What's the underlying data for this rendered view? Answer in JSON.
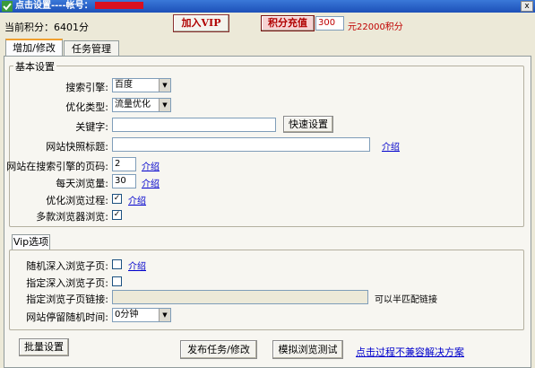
{
  "window": {
    "title": "点击设置----帐号：",
    "close": "x"
  },
  "topbar": {
    "points_label": "当前积分：6401分",
    "vip_button": "加入VIP",
    "recharge_button": "积分充值",
    "recharge_amount": "300",
    "recharge_rate": "元22000积分"
  },
  "tabs": [
    "增加/修改",
    "任务管理"
  ],
  "basic": {
    "legend": "基本设置",
    "search_engine_label": "搜索引擎:",
    "search_engine_value": "百度",
    "optimize_type_label": "优化类型:",
    "optimize_type_value": "流量优化",
    "keyword_label": "关键字:",
    "keyword_value": "",
    "quick_setup_button": "快速设置",
    "snapshot_title_label": "网站快照标题:",
    "snapshot_title_value": "",
    "snapshot_intro": "介绍",
    "page_number_label": "网站在搜索引擎的页码:",
    "page_number_value": "2",
    "page_number_intro": "介绍",
    "daily_views_label": "每天浏览量:",
    "daily_views_value": "30",
    "daily_views_intro": "介绍",
    "optimize_browse_label": "优化浏览过程:",
    "optimize_browse_checked": "✓",
    "optimize_browse_intro": "介绍",
    "multi_browser_label": "多款浏览器浏览:",
    "multi_browser_checked": "✓"
  },
  "vip": {
    "tab_label": "Vip选项",
    "random_depth_label": "随机深入浏览子页:",
    "random_depth_intro": "介绍",
    "specify_depth_label": "指定深入浏览子页:",
    "subpage_link_label": "指定浏览子页链接:",
    "subpage_link_value": "",
    "subpage_link_hint": "可以半匹配链接",
    "stay_time_label": "网站停留随机时间:",
    "stay_time_value": "0分钟"
  },
  "footer": {
    "batch_button": "批量设置",
    "publish_button": "发布任务/修改",
    "simulate_button": "模拟浏览测试",
    "incompat_link": "点击过程不兼容解决方案"
  },
  "colors": {
    "titlebar": "#1d50b8",
    "accent_red": "#b00000",
    "link": "#0000cc",
    "background": "#ece9d8"
  }
}
